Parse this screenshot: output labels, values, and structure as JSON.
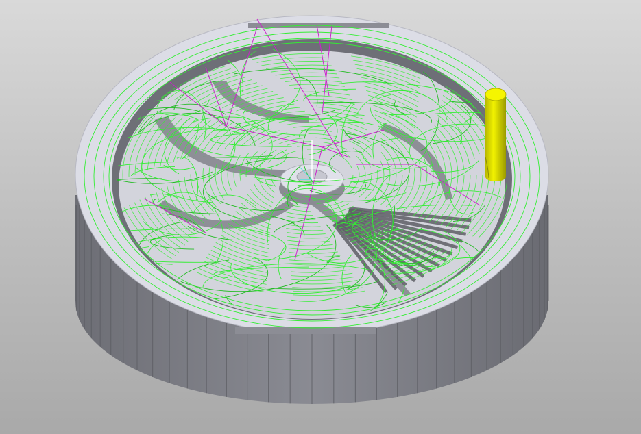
{
  "viewport": {
    "name": "cam-toolpath-3d-view",
    "background_top": "#d9d9d9",
    "background_bottom": "#a9a9a9"
  },
  "colors": {
    "part_wall": "#7f8087",
    "part_wall_shadow": "#5c5d63",
    "part_top_face": "#dcdde6",
    "part_floor": "#cfd0d8",
    "toolpath": "#33ee33",
    "toolpath_dark": "#22bb22",
    "rapid_moves": "#cc22cc",
    "tool": "#e6e600",
    "tool_shade": "#a8a800",
    "cyan_marker": "#55dddd"
  },
  "icons": {
    "tool": "cylinder-end-mill-icon",
    "origin": "coordinate-origin-icon"
  },
  "labels": []
}
